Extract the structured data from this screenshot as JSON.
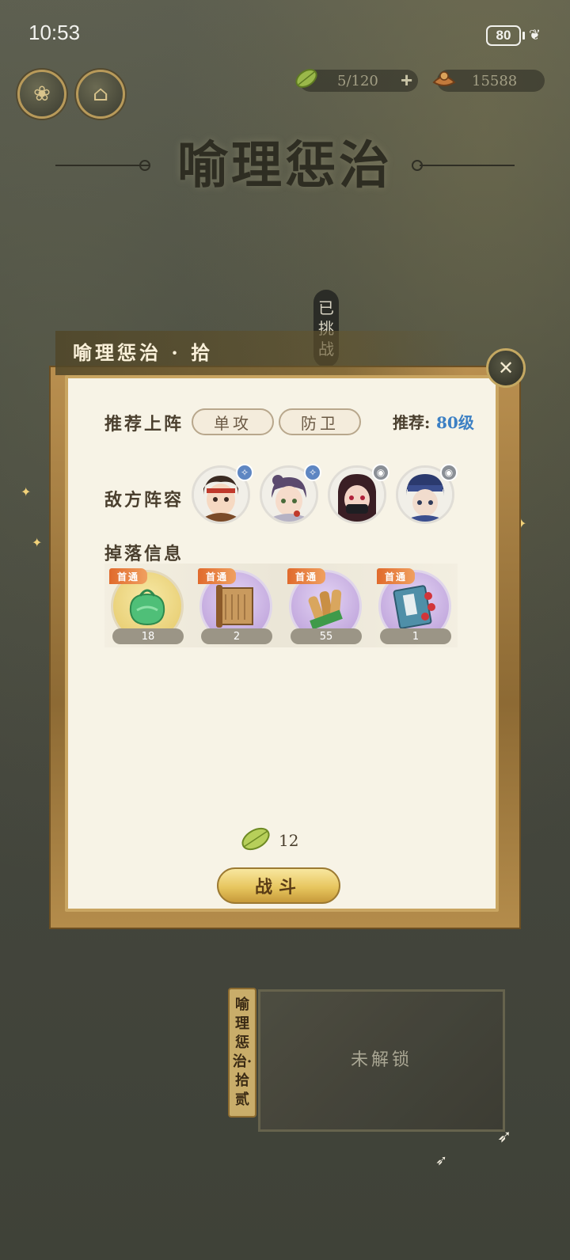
{
  "status_bar": {
    "time": "10:53",
    "battery": "80"
  },
  "resources": {
    "stamina": "5/120",
    "add_symbol": "+",
    "gold": "15588"
  },
  "page_title": "喻理惩治",
  "challenged_tag": "已挑战",
  "panel": {
    "title": "喻理惩治 · 拾",
    "recommend_label": "推荐上阵",
    "roles": [
      "单攻",
      "防卫"
    ],
    "recommend_level_label": "推荐:",
    "recommend_level_value": "80级",
    "enemy_label": "敌方阵容",
    "drop_label": "掉落信息",
    "first_clear_tag": "首通",
    "drops": [
      {
        "item": "jade-pendant",
        "count": "18"
      },
      {
        "item": "scroll",
        "count": "2"
      },
      {
        "item": "scroll-bundle",
        "count": "55"
      },
      {
        "item": "book",
        "count": "1"
      }
    ],
    "cost": "12",
    "battle_button": "战斗"
  },
  "next_level": {
    "tag": "喻理惩治·拾贰",
    "locked_text": "未解锁"
  },
  "colors": {
    "accent_gold": "#c9a561",
    "level_blue": "#3d80c4",
    "first_tag_orange": "#e06a2c"
  }
}
